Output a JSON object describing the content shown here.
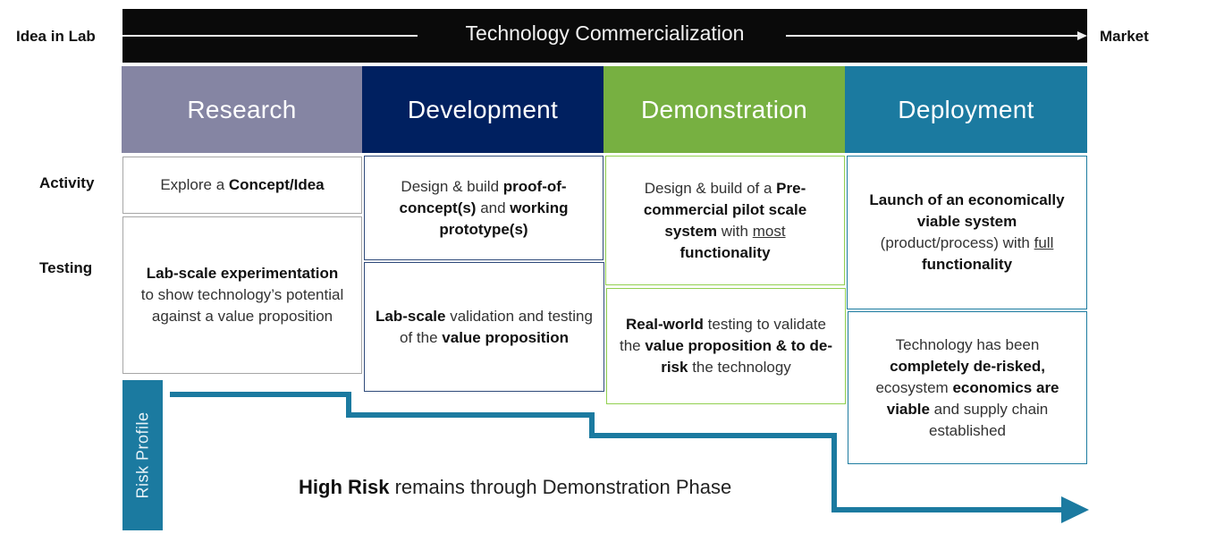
{
  "labels": {
    "start": "Idea in Lab",
    "end": "Market",
    "title": "Technology Commercialization",
    "activity": "Activity",
    "testing": "Testing",
    "risk_profile": "Risk Profile"
  },
  "colors": {
    "research": "#8585a3",
    "development": "#002060",
    "demonstration": "#77b041",
    "deployment": "#1b7aa0",
    "risk_line": "#1b7aa0"
  },
  "phases": [
    {
      "name": "Research"
    },
    {
      "name": "Development"
    },
    {
      "name": "Demonstration"
    },
    {
      "name": "Deployment"
    }
  ],
  "research": {
    "activity": {
      "pre": "Explore a ",
      "bold": "Concept/Idea"
    },
    "testing": {
      "bold": "Lab-scale experimentation",
      "rest": "to show technology’s potential against a value proposition"
    }
  },
  "development": {
    "activity": {
      "t1": "Design & build ",
      "b1": "proof-of-concept(s)",
      "t2": " and ",
      "b2": "working prototype(s)"
    },
    "testing": {
      "b1": "Lab-scale",
      "t1": " validation and testing of the ",
      "b2": "value proposition"
    }
  },
  "demonstration": {
    "activity": {
      "t1": "Design & build of a ",
      "b1": "Pre-commercial pilot scale system",
      "t2": " with ",
      "u1": "most",
      "b2": "functionality"
    },
    "testing": {
      "b1": "Real-world",
      "t1": " testing to validate the ",
      "b2": "value proposition & to de-risk",
      "t2": " the technology"
    }
  },
  "deployment": {
    "activity": {
      "b1": "Launch of an economically viable system",
      "t1": "(product/process) with ",
      "u1": "full",
      "b2": "functionality"
    },
    "testing": {
      "t1": "Technology has been ",
      "b1": "completely de-risked,",
      "t2": " ecosystem ",
      "b2": "economics are viable",
      "t3": " and supply chain established"
    }
  },
  "risk": {
    "bold": "High Risk",
    "rest": " remains through Demonstration Phase"
  }
}
